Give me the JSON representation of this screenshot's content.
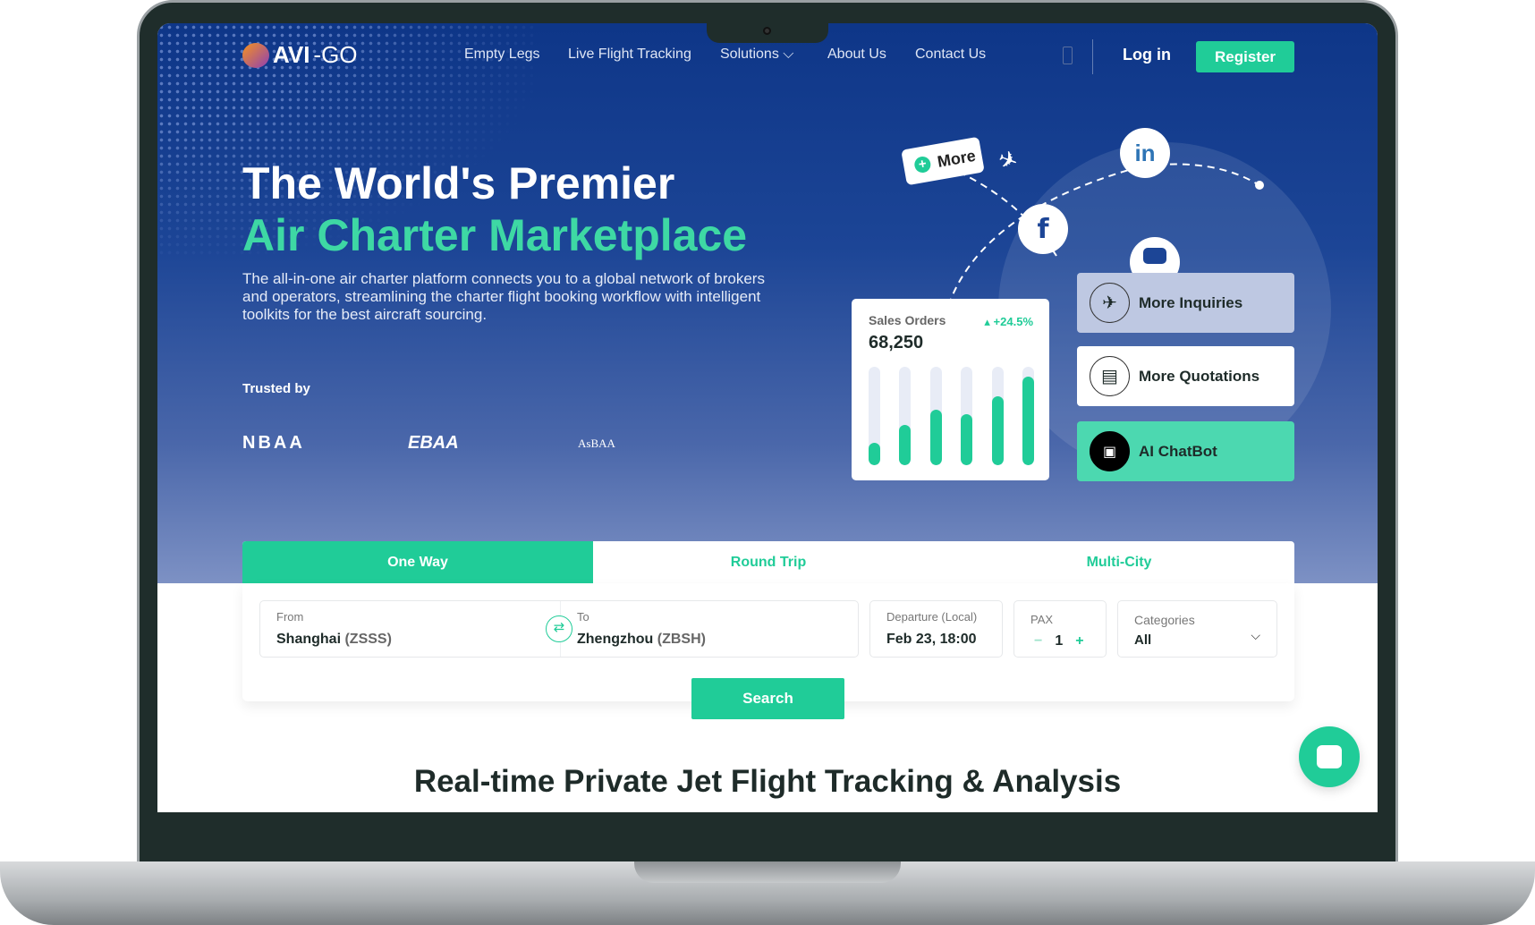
{
  "brand": {
    "name_a": "AVI",
    "name_b": "-GO"
  },
  "nav": {
    "items": [
      "Empty Legs",
      "Live Flight Tracking",
      "Solutions",
      "About Us",
      "Contact Us"
    ],
    "login": "Log in",
    "register": "Register"
  },
  "hero": {
    "title_line1": "The World's Premier",
    "title_line2": "Air Charter Marketplace",
    "description": "The all-in-one air charter platform connects you to a global network of brokers and operators, streamlining the charter flight booking workflow with intelligent toolkits for the best aircraft sourcing.",
    "trusted_label": "Trusted by",
    "partners": [
      "NBAA",
      "EBAA",
      "AsBAA"
    ]
  },
  "graphic": {
    "more_tag": "More",
    "socials": [
      "linkedin",
      "facebook",
      "youtube"
    ],
    "sales_card": {
      "label": "Sales Orders",
      "change": "+24.5%",
      "value": "68,250",
      "bar_levels": [
        0.23,
        0.41,
        0.56,
        0.52,
        0.7,
        0.9
      ]
    },
    "actions": [
      {
        "label": "More Inquiries",
        "icon": "airplane-icon"
      },
      {
        "label": "More Quotations",
        "icon": "quotation-icon"
      },
      {
        "label": "AI ChatBot",
        "icon": "robot-icon"
      }
    ]
  },
  "booking": {
    "tabs": [
      "One Way",
      "Round Trip",
      "Multi-City"
    ],
    "active_tab": "One Way",
    "from": {
      "label": "From",
      "city": "Shanghai",
      "code": "(ZSSS)"
    },
    "to": {
      "label": "To",
      "city": "Zhengzhou",
      "code": "(ZBSH)"
    },
    "departure": {
      "label": "Departure (Local)",
      "value": "Feb 23, 18:00"
    },
    "pax": {
      "label": "PAX",
      "value": "1",
      "minus": "−",
      "plus": "+"
    },
    "categories": {
      "label": "Categories",
      "value": "All"
    },
    "search": "Search"
  },
  "section": {
    "heading": "Real-time Private Jet Flight Tracking & Analysis"
  },
  "colors": {
    "accent": "#20cc98",
    "hero": "#1c4596",
    "text": "#1e2b29"
  }
}
